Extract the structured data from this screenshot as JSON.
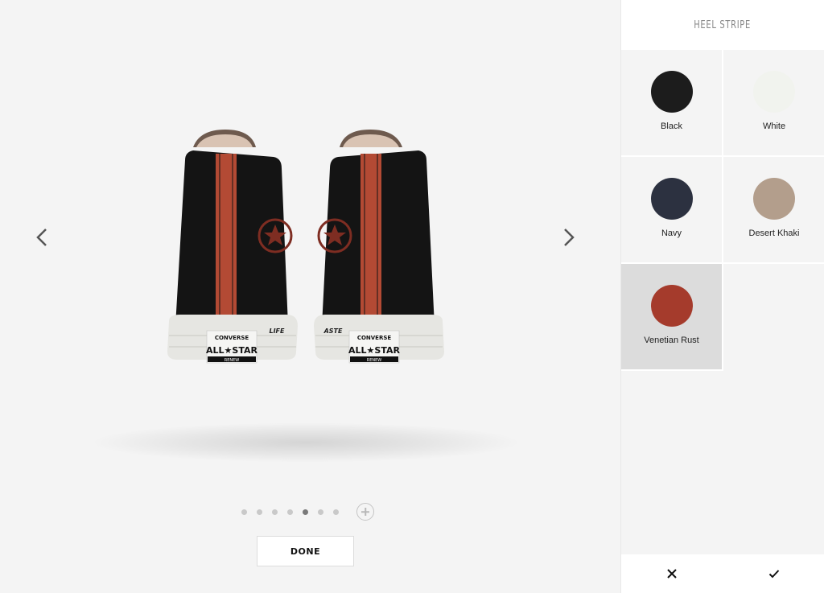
{
  "panel": {
    "title": "HEEL STRIPE",
    "swatches": [
      {
        "label": "Black",
        "color": "#1c1c1c",
        "selected": false
      },
      {
        "label": "White",
        "color": "#f1f3ee",
        "selected": false
      },
      {
        "label": "Navy",
        "color": "#2c3140",
        "selected": false
      },
      {
        "label": "Desert Khaki",
        "color": "#b39e8c",
        "selected": false
      },
      {
        "label": "Venetian Rust",
        "color": "#a53b2c",
        "selected": true
      }
    ],
    "cancel_icon": "close-icon",
    "confirm_icon": "check-icon"
  },
  "viewer": {
    "prev_icon": "chevron-left-icon",
    "next_icon": "chevron-right-icon",
    "pager": {
      "count": 7,
      "active_index": 4,
      "add_icon": "plus-icon"
    },
    "done_label": "DONE",
    "shoe": {
      "upper_color": "#141414",
      "stripe_color": "#b34a34",
      "sole_color": "#e6e6e2",
      "heel_label_lines": [
        "CONVERSE",
        "ALL★STAR",
        "RENEW"
      ],
      "side_text_left": "LIFE",
      "side_text_right": "ASTE"
    }
  }
}
